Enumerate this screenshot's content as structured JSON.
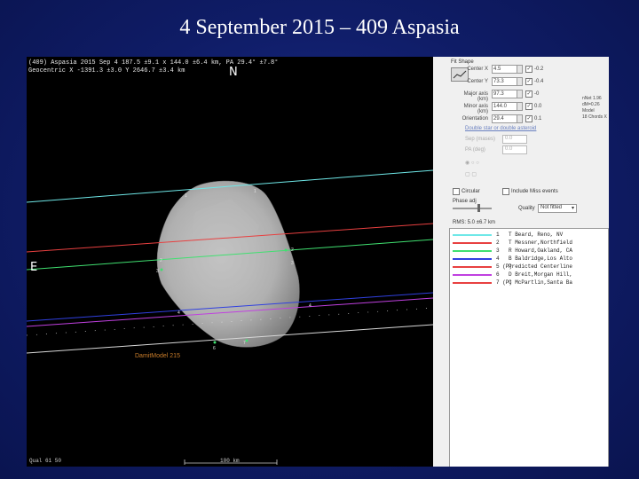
{
  "slide": {
    "title": "4 September 2015 – 409 Aspasia"
  },
  "plot": {
    "header_line1": "(409) Aspasia 2015 Sep 4   187.5 ±9.1 x 144.0 ±6.4 km, PA 29.4° ±7.8°",
    "header_line2": "Geocentric X -1391.3 ±3.0  Y 2646.7 ±3.4 km",
    "north_label": "N",
    "east_label": "E",
    "model_label": "DamitModel 215",
    "qual_label": "Qual 61 50",
    "scale_label": "100 km",
    "chord_colors": [
      "#6fe8e8",
      "#e84040",
      "#40e070",
      "#3040e0",
      "#d8d8d8",
      "#c040e0",
      "#d8d8d8"
    ]
  },
  "panel": {
    "fit_shape": "Fit Shape",
    "rows": [
      {
        "label": "Center X",
        "value": "4.5",
        "checked": true,
        "delta": "-0.2"
      },
      {
        "label": "Center Y",
        "value": "73.3",
        "checked": true,
        "delta": "-0.4"
      },
      {
        "label": "Major axis (km)",
        "value": "97.3",
        "checked": true,
        "delta": "-0"
      },
      {
        "label": "Minor axis (km)",
        "value": "144.0",
        "checked": true,
        "delta": "0.0"
      },
      {
        "label": "Orientation",
        "value": "29.4",
        "checked": true,
        "delta": "0.1"
      }
    ],
    "side_info": [
      "nNet 1.96",
      "dM=0.26",
      "Model",
      "18 Chords X"
    ],
    "double_star_link": "Double star or double asteroid",
    "sep_label": "Sep (mases)",
    "pa_label": "PA (deg)",
    "sep_value": "0.0",
    "pa_value": "0.0",
    "circular_label": "Circular",
    "include_misses_label": "Include Miss events",
    "phase_label": "Phase adj",
    "quality_label": "Quality",
    "quality_value": "Not fitted",
    "rms_label": "RMS: 5.0   ±6.7 km"
  },
  "observers": [
    {
      "num": "1",
      "name": "T Beard, Reno, NV",
      "color": "#6fe8e8"
    },
    {
      "num": "2",
      "name": "T Messner,Northfield",
      "color": "#e84040"
    },
    {
      "num": "3",
      "name": "R Howard,Oakland, CA",
      "color": "#40e070"
    },
    {
      "num": "4",
      "name": "B Baldridge,Los Alto",
      "color": "#3040e0"
    },
    {
      "num": "5 (P)",
      "name": "Predicted Centerline",
      "color": "#e84040"
    },
    {
      "num": "6",
      "name": "D Breit,Morgan Hill,",
      "color": "#c040e0"
    },
    {
      "num": "7 (P)",
      "name": "C McPartlin,Santa Ba",
      "color": "#e84040"
    }
  ]
}
